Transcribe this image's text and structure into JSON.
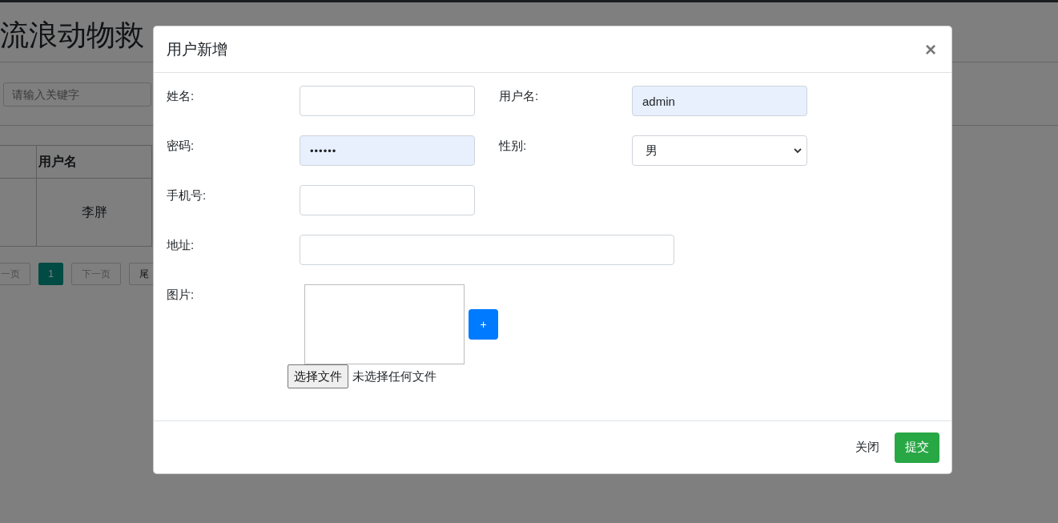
{
  "page": {
    "title": "流浪动物救",
    "search": {
      "placeholder": "请输入关键字"
    },
    "table": {
      "columns": [
        "用户名"
      ],
      "rows": [
        [
          "李胖"
        ]
      ]
    },
    "pagination": [
      {
        "label": "一页",
        "selected": false
      },
      {
        "label": "1",
        "selected": true
      },
      {
        "label": "下一页",
        "selected": false
      },
      {
        "label": "尾",
        "selected": false
      }
    ]
  },
  "dialog": {
    "title": "用户新增",
    "close": "×",
    "rows": [
      [
        {
          "label": "姓名:",
          "kind": "text",
          "autofilled": false
        },
        {
          "label": "用户名:",
          "kind": "text",
          "value": "admin",
          "autofilled": true
        }
      ],
      [
        {
          "label": "密码:",
          "kind": "password",
          "value": "••••••",
          "autofilled": true
        },
        {
          "label": "性别:",
          "kind": "select",
          "value": "男",
          "autofilled": false
        }
      ],
      [
        {
          "label": "手机号:",
          "kind": "text",
          "autofilled": false
        }
      ],
      [
        {
          "label": "地址:",
          "kind": "wide",
          "autofilled": false
        }
      ]
    ],
    "image": {
      "label": "图片:",
      "add_button": "+",
      "file_button": "选择文件",
      "file_status": "未选择任何文件"
    },
    "buttons": [
      {
        "label": "关闭",
        "kind": "secondary"
      },
      {
        "label": "提交",
        "kind": "primary"
      }
    ]
  }
}
